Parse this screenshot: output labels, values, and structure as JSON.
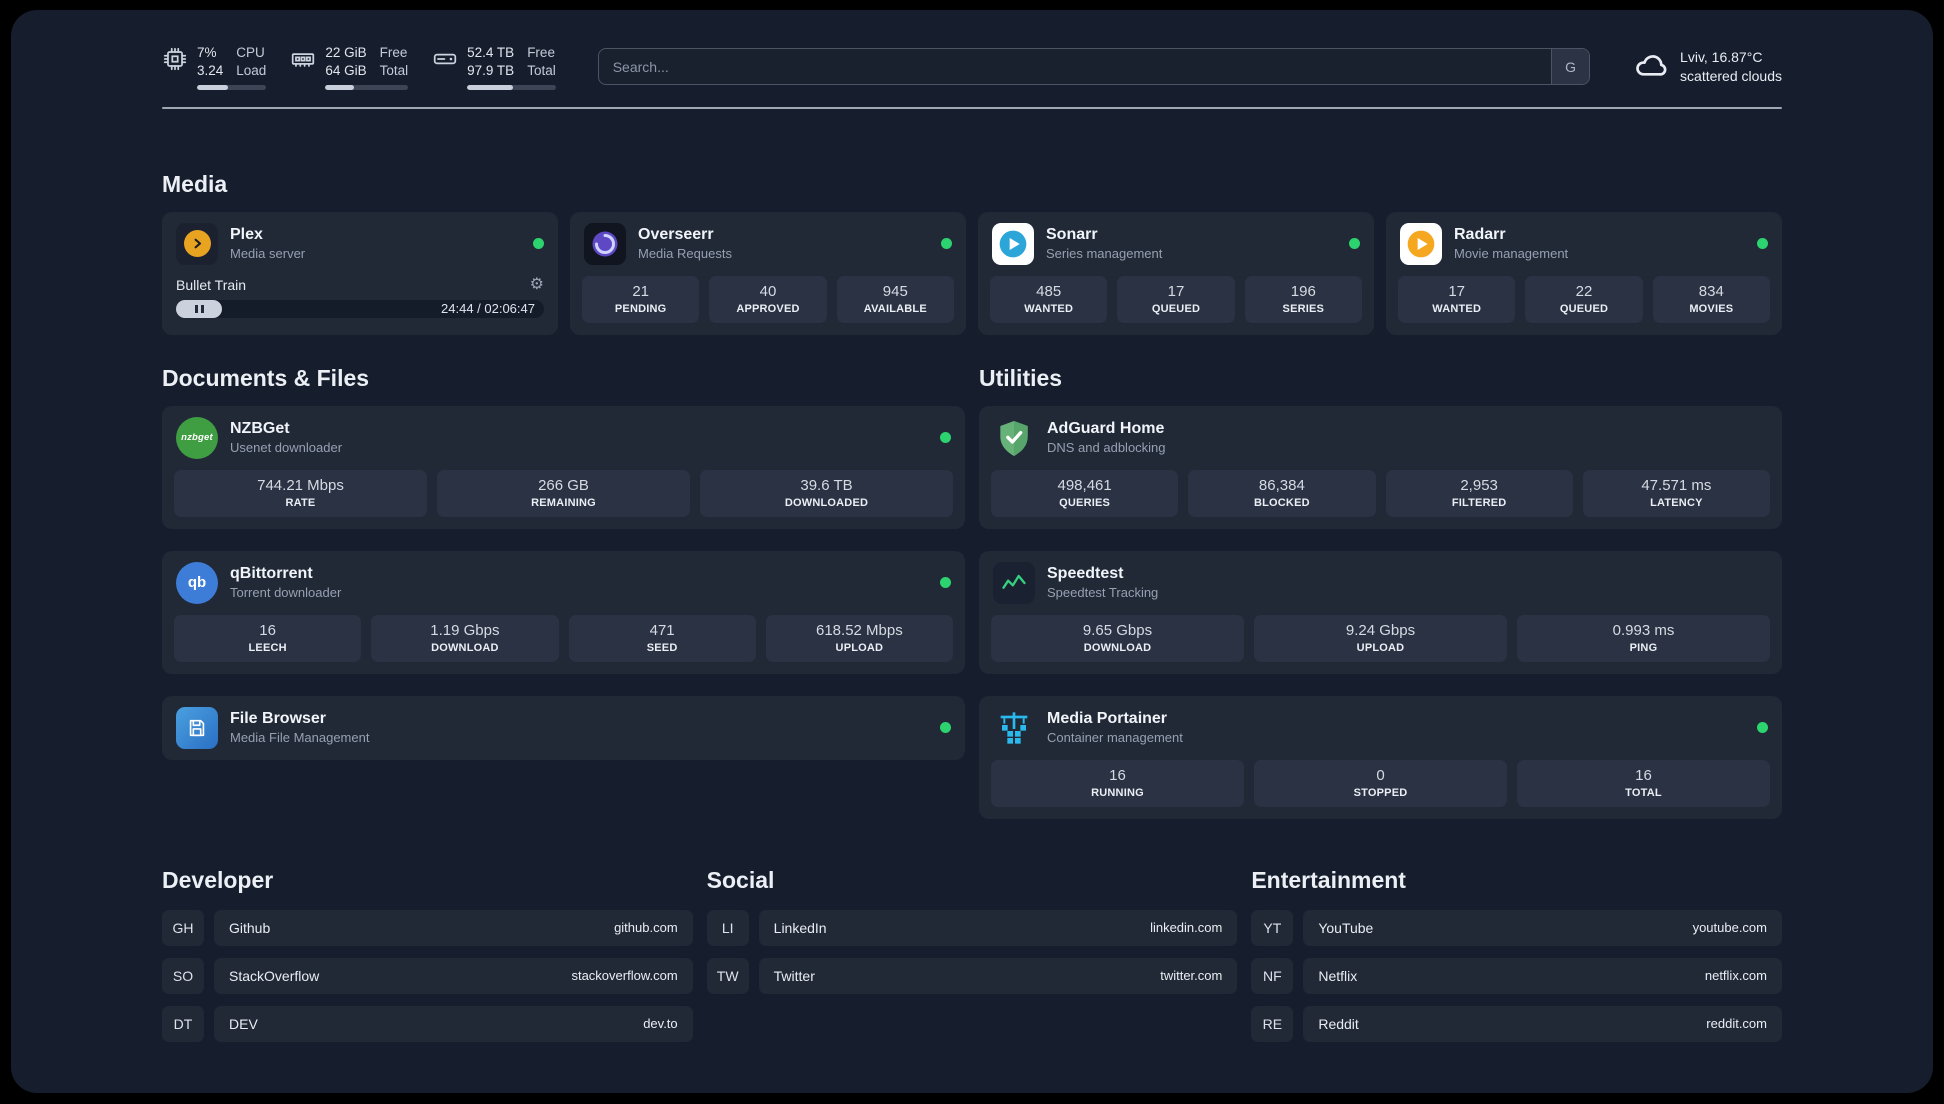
{
  "glyphs": {
    "gear": "⚙"
  },
  "topbar": {
    "cpu": {
      "percent": "7%",
      "load": "3.24",
      "label_top": "CPU",
      "label_bottom": "Load",
      "bar_percent": 45
    },
    "memory": {
      "free": "22 GiB",
      "total": "64 GiB",
      "label_top": "Free",
      "label_bottom": "Total",
      "bar_percent": 35
    },
    "disk": {
      "free": "52.4 TB",
      "total": "97.9 TB",
      "label_top": "Free",
      "label_bottom": "Total",
      "bar_percent": 52
    },
    "search": {
      "placeholder": "Search...",
      "engine_label": "G"
    },
    "weather": {
      "location": "Lviv, 16.87°C",
      "condition": "scattered clouds"
    }
  },
  "media": {
    "title": "Media",
    "apps": [
      {
        "name": "Plex",
        "subtitle": "Media server",
        "online": true,
        "player": {
          "track": "Bullet Train",
          "time": "24:44 / 02:06:47"
        }
      },
      {
        "name": "Overseerr",
        "subtitle": "Media Requests",
        "online": true,
        "stats": [
          {
            "value": "21",
            "label": "PENDING"
          },
          {
            "value": "40",
            "label": "APPROVED"
          },
          {
            "value": "945",
            "label": "AVAILABLE"
          }
        ]
      },
      {
        "name": "Sonarr",
        "subtitle": "Series management",
        "online": true,
        "stats": [
          {
            "value": "485",
            "label": "WANTED"
          },
          {
            "value": "17",
            "label": "QUEUED"
          },
          {
            "value": "196",
            "label": "SERIES"
          }
        ]
      },
      {
        "name": "Radarr",
        "subtitle": "Movie management",
        "online": true,
        "stats": [
          {
            "value": "17",
            "label": "WANTED"
          },
          {
            "value": "22",
            "label": "QUEUED"
          },
          {
            "value": "834",
            "label": "MOVIES"
          }
        ]
      }
    ]
  },
  "documents": {
    "title": "Documents & Files",
    "apps": [
      {
        "name": "NZBGet",
        "subtitle": "Usenet downloader",
        "online": true,
        "icon_text": "nzbget",
        "stats": [
          {
            "value": "744.21 Mbps",
            "label": "RATE"
          },
          {
            "value": "266 GB",
            "label": "REMAINING"
          },
          {
            "value": "39.6 TB",
            "label": "DOWNLOADED"
          }
        ]
      },
      {
        "name": "qBittorrent",
        "subtitle": "Torrent downloader",
        "online": true,
        "icon_text": "qb",
        "stats": [
          {
            "value": "16",
            "label": "LEECH"
          },
          {
            "value": "1.19 Gbps",
            "label": "DOWNLOAD"
          },
          {
            "value": "471",
            "label": "SEED"
          },
          {
            "value": "618.52 Mbps",
            "label": "UPLOAD"
          }
        ]
      },
      {
        "name": "File Browser",
        "subtitle": "Media File Management",
        "online": true
      }
    ]
  },
  "utilities": {
    "title": "Utilities",
    "apps": [
      {
        "name": "AdGuard Home",
        "subtitle": "DNS and adblocking",
        "stats": [
          {
            "value": "498,461",
            "label": "QUERIES"
          },
          {
            "value": "86,384",
            "label": "BLOCKED"
          },
          {
            "value": "2,953",
            "label": "FILTERED"
          },
          {
            "value": "47.571 ms",
            "label": "LATENCY"
          }
        ]
      },
      {
        "name": "Speedtest",
        "subtitle": "Speedtest Tracking",
        "stats": [
          {
            "value": "9.65 Gbps",
            "label": "DOWNLOAD"
          },
          {
            "value": "9.24 Gbps",
            "label": "UPLOAD"
          },
          {
            "value": "0.993 ms",
            "label": "PING"
          }
        ]
      },
      {
        "name": "Media Portainer",
        "subtitle": "Container management",
        "online": true,
        "stats": [
          {
            "value": "16",
            "label": "RUNNING"
          },
          {
            "value": "0",
            "label": "STOPPED"
          },
          {
            "value": "16",
            "label": "TOTAL"
          }
        ]
      }
    ]
  },
  "bookmarks": [
    {
      "title": "Developer",
      "links": [
        {
          "abbr": "GH",
          "name": "Github",
          "url": "github.com"
        },
        {
          "abbr": "SO",
          "name": "StackOverflow",
          "url": "stackoverflow.com"
        },
        {
          "abbr": "DT",
          "name": "DEV",
          "url": "dev.to"
        }
      ]
    },
    {
      "title": "Social",
      "links": [
        {
          "abbr": "LI",
          "name": "LinkedIn",
          "url": "linkedin.com"
        },
        {
          "abbr": "TW",
          "name": "Twitter",
          "url": "twitter.com"
        }
      ]
    },
    {
      "title": "Entertainment",
      "links": [
        {
          "abbr": "YT",
          "name": "YouTube",
          "url": "youtube.com"
        },
        {
          "abbr": "NF",
          "name": "Netflix",
          "url": "netflix.com"
        },
        {
          "abbr": "RE",
          "name": "Reddit",
          "url": "reddit.com"
        }
      ]
    }
  ],
  "colors": {
    "status_online": "#2dd36f",
    "accent_green": "#35d07f",
    "portainer_blue": "#29b9ec"
  }
}
